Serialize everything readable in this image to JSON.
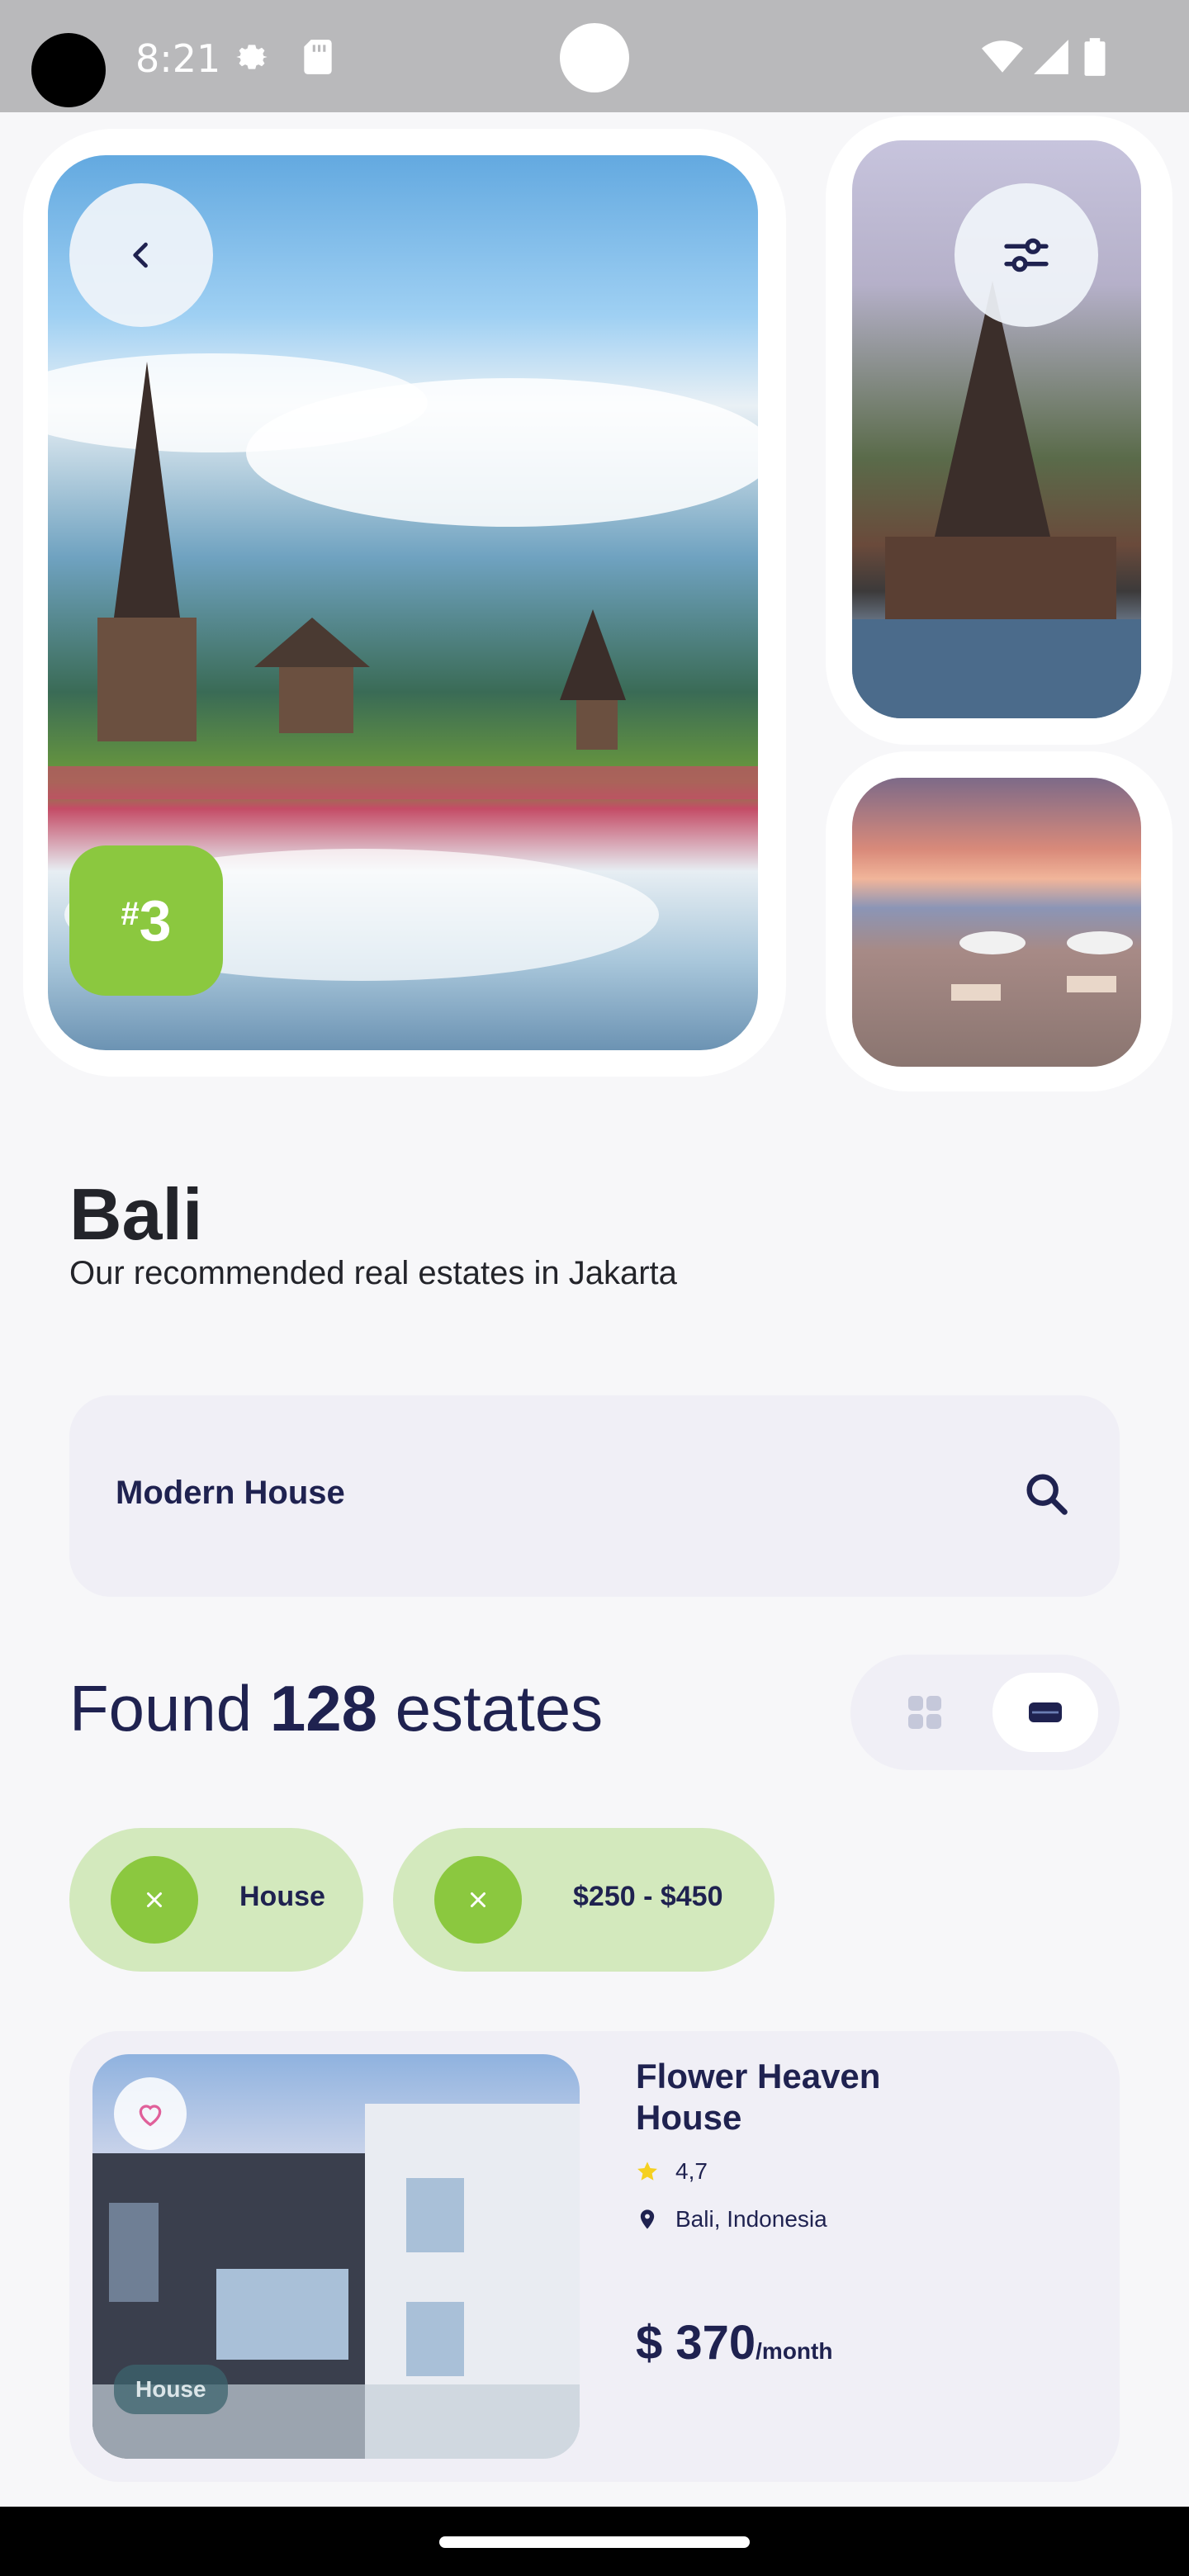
{
  "status_bar": {
    "time": "8:21",
    "icons": [
      "gear-icon",
      "sd-card-icon",
      "wifi-icon",
      "signal-icon",
      "battery-icon"
    ]
  },
  "gallery": {
    "rank_hash": "#",
    "rank_number": "3"
  },
  "header": {
    "title": "Bali",
    "subtitle": "Our recommended real estates in Jakarta"
  },
  "search": {
    "value": "Modern House"
  },
  "results": {
    "prefix": "Found ",
    "count": "128",
    "suffix": " estates"
  },
  "filters": [
    {
      "label": "House"
    },
    {
      "label": "$250 - $450"
    }
  ],
  "listing": {
    "title": "Flower Heaven House",
    "rating": "4,7",
    "location": "Bali, Indonesia",
    "price": "$ 370",
    "price_unit": "/month",
    "tag": "House"
  },
  "colors": {
    "accent_green": "#8bc83f",
    "chip_bg": "#d3e9bd",
    "navy": "#1f2250",
    "star": "#f5d020"
  }
}
